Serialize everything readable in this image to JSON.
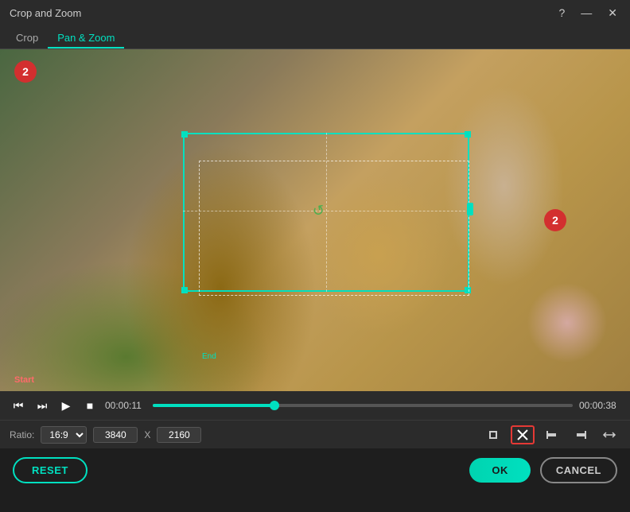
{
  "titlebar": {
    "title": "Crop and Zoom",
    "help_icon": "?",
    "minimize_icon": "—",
    "close_icon": "✕"
  },
  "tabs": [
    {
      "id": "crop",
      "label": "Crop",
      "active": false
    },
    {
      "id": "pan-zoom",
      "label": "Pan & Zoom",
      "active": true
    }
  ],
  "video": {
    "badge_left": "2",
    "badge_right": "2",
    "start_label": "Start",
    "end_label": "End"
  },
  "playback": {
    "current_time": "00:00:11",
    "total_time": "00:00:38",
    "progress_percent": 29
  },
  "toolbar": {
    "ratio_label": "Ratio:",
    "ratio_value": "16:9",
    "width": "3840",
    "height": "2160",
    "separator": "X"
  },
  "actions": {
    "reset_label": "RESET",
    "ok_label": "OK",
    "cancel_label": "CANCEL"
  },
  "icons": {
    "skip_back": "⏮",
    "frame_back": "⏭",
    "play": "▶",
    "stop": "■",
    "crop_icon": "⊹",
    "expand_icon": "⛶",
    "close_crop": "✕",
    "align_left": "⊢",
    "align_right": "⊣",
    "flip": "⇄"
  }
}
